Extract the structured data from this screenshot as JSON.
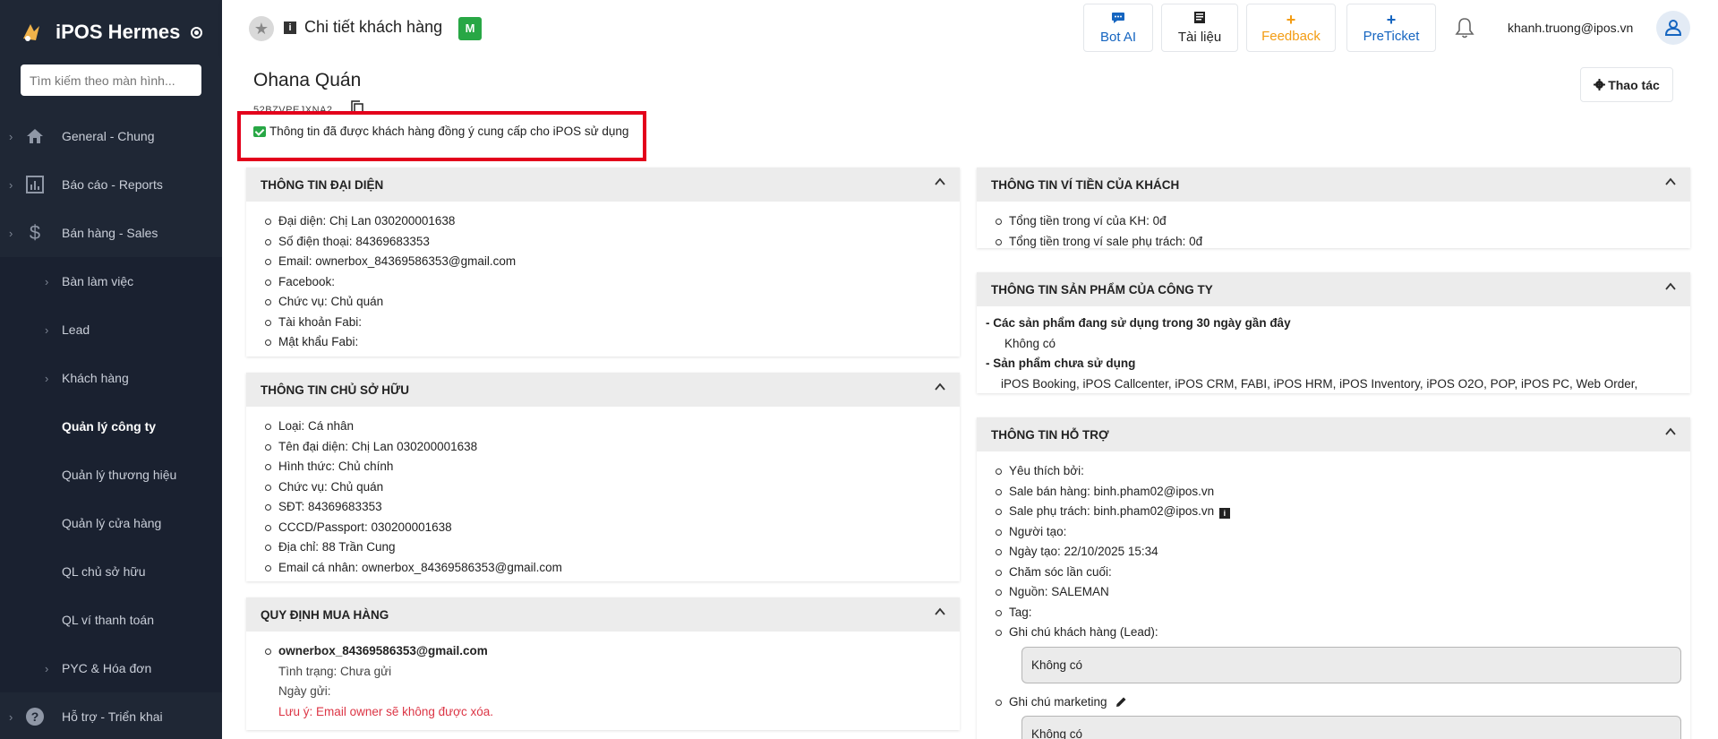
{
  "sidebar": {
    "brand": "iPOS Hermes",
    "search_placeholder": "Tìm kiếm theo màn hình...",
    "items": [
      {
        "label": "General - Chung"
      },
      {
        "label": "Báo cáo - Reports"
      },
      {
        "label": "Bán hàng - Sales"
      }
    ],
    "sub_items": [
      {
        "label": "Bàn làm việc"
      },
      {
        "label": "Lead"
      },
      {
        "label": "Khách hàng"
      },
      {
        "label": "Quản lý công ty"
      },
      {
        "label": "Quản lý thương hiệu"
      },
      {
        "label": "Quản lý cửa hàng"
      },
      {
        "label": "QL chủ sở hữu"
      },
      {
        "label": "QL ví thanh toán"
      },
      {
        "label": "PYC & Hóa đơn"
      }
    ],
    "bottom_item": {
      "label": "Hỗ trợ - Triển khai"
    }
  },
  "header": {
    "title": "Chi tiết khách hàng",
    "badge": "M",
    "buttons": {
      "bot_ai": "Bot AI",
      "docs": "Tài liệu",
      "feedback": "Feedback",
      "preticket": "PreTicket"
    },
    "user_email": "khanh.truong@ipos.vn"
  },
  "company": {
    "name": "Ohana Quán",
    "code": "52BZVPEJXNA2",
    "consent": "Thông tin đã được khách hàng đồng ý cung cấp cho iPOS sử dụng",
    "action_label": "Thao tác"
  },
  "rep": {
    "title": "THÔNG TIN ĐẠI DIỆN",
    "lines": [
      "Đại diện: Chị Lan 030200001638",
      "Số điện thoại: 84369683353",
      "Email: ownerbox_84369586353@gmail.com",
      "Facebook:",
      "Chức vụ: Chủ quán",
      "Tài khoản Fabi:",
      "Mật khẩu Fabi:"
    ]
  },
  "owner": {
    "title": "THÔNG TIN CHỦ SỞ HỮU",
    "lines": [
      "Loại: Cá nhân",
      "Tên đại diện: Chị Lan 030200001638",
      "Hình thức: Chủ chính",
      "Chức vụ: Chủ quán",
      "SĐT: 84369683353",
      "CCCD/Passport: 030200001638",
      "Địa chỉ: 88 Trần Cung",
      "Email cá nhân: ownerbox_84369586353@gmail.com"
    ]
  },
  "purchase": {
    "title": "QUY ĐỊNH MUA HÀNG",
    "email": "ownerbox_84369586353@gmail.com",
    "status": "Tình trạng: Chưa gửi",
    "sent_date": "Ngày gửi:",
    "note": "Lưu ý: Email owner sẽ không được xóa."
  },
  "wallet": {
    "title": "THÔNG TIN VÍ TIỀN CỦA KHÁCH",
    "lines": [
      "Tổng tiền trong ví của KH: 0đ",
      "Tổng tiền trong ví sale phụ trách: 0đ"
    ]
  },
  "products": {
    "title": "THÔNG TIN SẢN PHẨM CỦA CÔNG TY",
    "in_use_heading": "- Các sản phẩm đang sử dụng trong 30 ngày gần đây",
    "in_use_value": "Không có",
    "unused_heading": "- Sản phẩm chưa sử dụng",
    "unused_value": "iPOS Booking, iPOS Callcenter, iPOS CRM, FABI, iPOS HRM, iPOS Inventory, iPOS O2O, POP, iPOS PC, Web Order,"
  },
  "support": {
    "title": "THÔNG TIN HỖ TRỢ",
    "lines": [
      "Yêu thích bởi:",
      "Sale bán hàng: binh.pham02@ipos.vn",
      "Sale phụ trách: binh.pham02@ipos.vn",
      "Người tạo:",
      "Ngày tạo: 22/10/2025 15:34",
      "Chăm sóc lần cuối:",
      "Nguồn: SALEMAN",
      "Tag:",
      "Ghi chú khách hàng (Lead):"
    ],
    "lead_note": "Không có",
    "marketing_label": "Ghi chú marketing",
    "marketing_note": "Không có"
  },
  "colors": {
    "sidebar_bg": "#1f2735",
    "accent_blue": "#1565c0",
    "feedback_orange": "#f39c12",
    "highlight_red": "#e3001b",
    "success_green": "#28a745"
  }
}
